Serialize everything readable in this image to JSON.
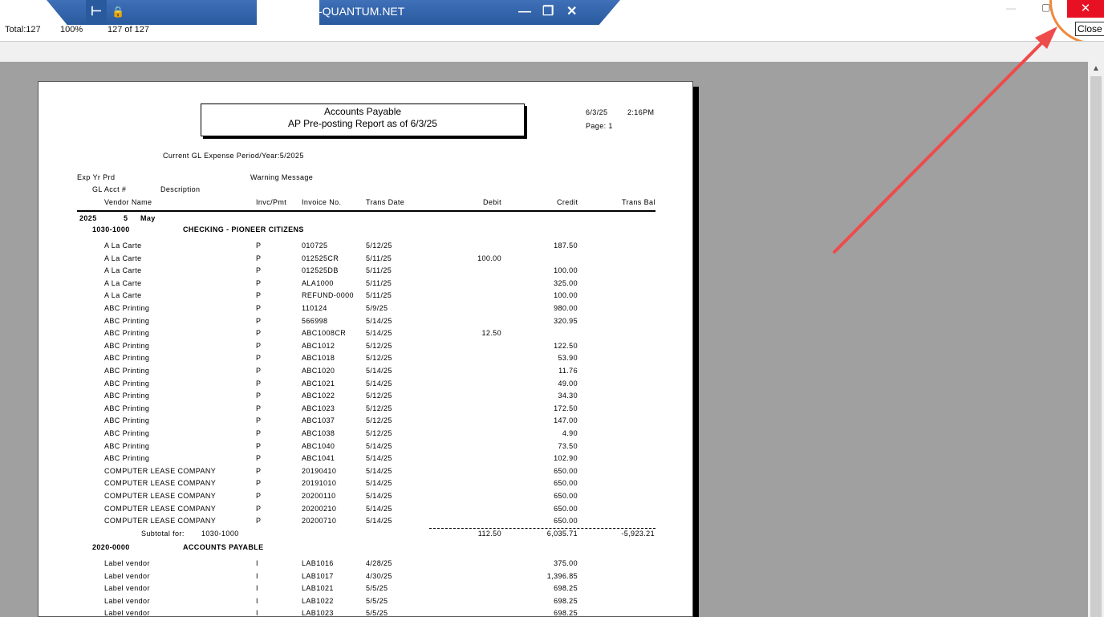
{
  "remote": {
    "title": "-QUANTUM.NET",
    "pin_glyph": "⊢",
    "lock_glyph": "🔒",
    "min_glyph": "—",
    "restore_glyph": "❐",
    "close_glyph": "✕"
  },
  "host": {
    "min_glyph": "—",
    "max_glyph": "▢",
    "close_glyph": "✕",
    "close_tooltip": "Close"
  },
  "status": {
    "total": "Total:127",
    "zoom": "100%",
    "pages": "127 of 127"
  },
  "report": {
    "title_line1": "Accounts Payable",
    "title_line2": "AP Pre-posting Report as of 6/3/25",
    "date": "6/3/25",
    "time": "2:16PM",
    "page": "Page:  1",
    "period": "Current GL Expense Period/Year:5/2025",
    "headers": {
      "exp_yr_prd": "Exp Yr  Prd",
      "warning": "Warning Message",
      "gl_acct": "GL Acct #",
      "description": "Description",
      "vendor": "Vendor Name",
      "invc_pmt": "Invc/Pmt",
      "invoice_no": "Invoice No.",
      "trans_date": "Trans Date",
      "debit": "Debit",
      "credit": "Credit",
      "trans_bal": "Trans Bal"
    },
    "period_year": "2025",
    "period_no": "5",
    "period_month": "May",
    "group1": {
      "acct": "1030-1000",
      "name": "CHECKING - PIONEER CITIZENS"
    },
    "rows1": [
      {
        "vendor": "A La Carte",
        "type": "P",
        "inv": "010725",
        "date": "5/12/25",
        "debit": "",
        "credit": "187.50"
      },
      {
        "vendor": "A La Carte",
        "type": "P",
        "inv": "012525CR",
        "date": "5/11/25",
        "debit": "100.00",
        "credit": ""
      },
      {
        "vendor": "A La Carte",
        "type": "P",
        "inv": "012525DB",
        "date": "5/11/25",
        "debit": "",
        "credit": "100.00"
      },
      {
        "vendor": "A La Carte",
        "type": "P",
        "inv": "ALA1000",
        "date": "5/11/25",
        "debit": "",
        "credit": "325.00"
      },
      {
        "vendor": "A La Carte",
        "type": "P",
        "inv": "REFUND-0000",
        "date": "5/11/25",
        "debit": "",
        "credit": "100.00"
      },
      {
        "vendor": "ABC Printing",
        "type": "P",
        "inv": "110124",
        "date": "5/9/25",
        "debit": "",
        "credit": "980.00"
      },
      {
        "vendor": "ABC Printing",
        "type": "P",
        "inv": "566998",
        "date": "5/14/25",
        "debit": "",
        "credit": "320.95"
      },
      {
        "vendor": "ABC Printing",
        "type": "P",
        "inv": "ABC1008CR",
        "date": "5/14/25",
        "debit": "12.50",
        "credit": ""
      },
      {
        "vendor": "ABC Printing",
        "type": "P",
        "inv": "ABC1012",
        "date": "5/12/25",
        "debit": "",
        "credit": "122.50"
      },
      {
        "vendor": "ABC Printing",
        "type": "P",
        "inv": "ABC1018",
        "date": "5/12/25",
        "debit": "",
        "credit": "53.90"
      },
      {
        "vendor": "ABC Printing",
        "type": "P",
        "inv": "ABC1020",
        "date": "5/14/25",
        "debit": "",
        "credit": "11.76"
      },
      {
        "vendor": "ABC Printing",
        "type": "P",
        "inv": "ABC1021",
        "date": "5/14/25",
        "debit": "",
        "credit": "49.00"
      },
      {
        "vendor": "ABC Printing",
        "type": "P",
        "inv": "ABC1022",
        "date": "5/12/25",
        "debit": "",
        "credit": "34.30"
      },
      {
        "vendor": "ABC Printing",
        "type": "P",
        "inv": "ABC1023",
        "date": "5/12/25",
        "debit": "",
        "credit": "172.50"
      },
      {
        "vendor": "ABC Printing",
        "type": "P",
        "inv": "ABC1037",
        "date": "5/12/25",
        "debit": "",
        "credit": "147.00"
      },
      {
        "vendor": "ABC Printing",
        "type": "P",
        "inv": "ABC1038",
        "date": "5/12/25",
        "debit": "",
        "credit": "4.90"
      },
      {
        "vendor": "ABC Printing",
        "type": "P",
        "inv": "ABC1040",
        "date": "5/14/25",
        "debit": "",
        "credit": "73.50"
      },
      {
        "vendor": "ABC Printing",
        "type": "P",
        "inv": "ABC1041",
        "date": "5/14/25",
        "debit": "",
        "credit": "102.90"
      },
      {
        "vendor": "COMPUTER LEASE COMPANY",
        "type": "P",
        "inv": "20190410",
        "date": "5/14/25",
        "debit": "",
        "credit": "650.00"
      },
      {
        "vendor": "COMPUTER LEASE COMPANY",
        "type": "P",
        "inv": "20191010",
        "date": "5/14/25",
        "debit": "",
        "credit": "650.00"
      },
      {
        "vendor": "COMPUTER LEASE COMPANY",
        "type": "P",
        "inv": "20200110",
        "date": "5/14/25",
        "debit": "",
        "credit": "650.00"
      },
      {
        "vendor": "COMPUTER LEASE COMPANY",
        "type": "P",
        "inv": "20200210",
        "date": "5/14/25",
        "debit": "",
        "credit": "650.00"
      },
      {
        "vendor": "COMPUTER LEASE COMPANY",
        "type": "P",
        "inv": "20200710",
        "date": "5/14/25",
        "debit": "",
        "credit": "650.00"
      }
    ],
    "subtotal": {
      "label": "Subtotal for:",
      "acct": "1030-1000",
      "debit": "112.50",
      "credit": "6,035.71",
      "bal": "-5,923.21"
    },
    "group2": {
      "acct": "2020-0000",
      "name": "ACCOUNTS PAYABLE"
    },
    "rows2": [
      {
        "vendor": "Label vendor",
        "type": "I",
        "inv": "LAB1016",
        "date": "4/28/25",
        "debit": "",
        "credit": "375.00"
      },
      {
        "vendor": "Label vendor",
        "type": "I",
        "inv": "LAB1017",
        "date": "4/30/25",
        "debit": "",
        "credit": "1,396.85"
      },
      {
        "vendor": "Label vendor",
        "type": "I",
        "inv": "LAB1021",
        "date": "5/5/25",
        "debit": "",
        "credit": "698.25"
      },
      {
        "vendor": "Label vendor",
        "type": "I",
        "inv": "LAB1022",
        "date": "5/5/25",
        "debit": "",
        "credit": "698.25"
      },
      {
        "vendor": "Label vendor",
        "type": "I",
        "inv": "LAB1023",
        "date": "5/5/25",
        "debit": "",
        "credit": "698.25"
      }
    ]
  },
  "colors": {
    "remote_bar": "#2a5a9e",
    "close_red": "#e81123",
    "arrow": "#ee4b4b",
    "highlight": "#f0893a"
  }
}
